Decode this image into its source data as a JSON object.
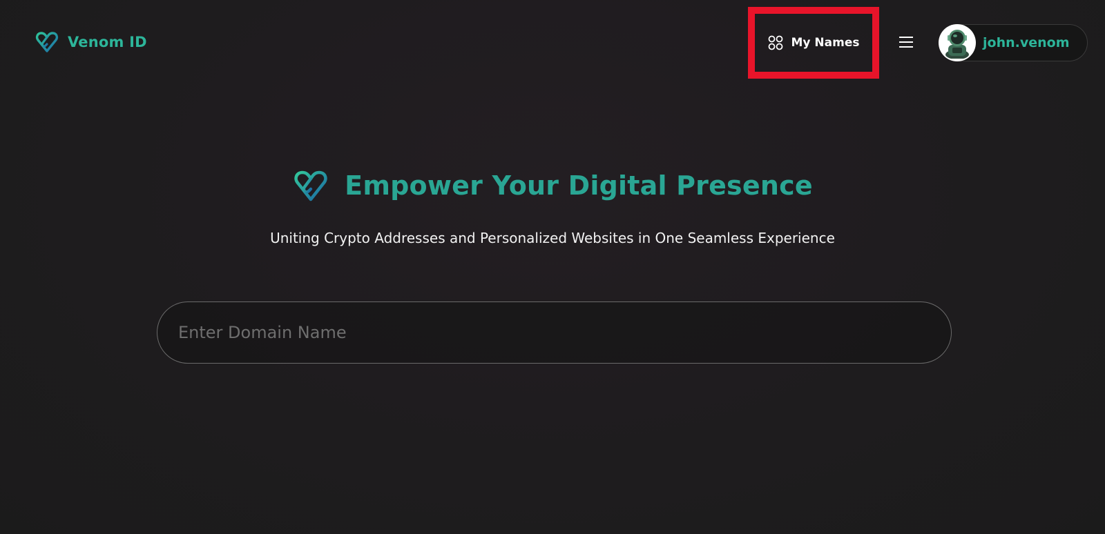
{
  "brand": {
    "name": "Venom ID",
    "logo_icon": "venom-logo-icon"
  },
  "nav": {
    "my_names_label": "My Names",
    "my_names_icon": "grid-circles-icon",
    "highlight_color": "#e8142a",
    "menu_icon": "hamburger-menu-icon"
  },
  "profile": {
    "name": "john.venom",
    "avatar_icon": "astronaut-avatar-icon"
  },
  "hero": {
    "title": "Empower Your Digital Presence",
    "subtitle": "Uniting Crypto Addresses and Personalized Websites in One Seamless Experience"
  },
  "search": {
    "placeholder": "Enter Domain Name",
    "value": ""
  },
  "colors": {
    "accent": "#2db59a",
    "accent_secondary": "#1f7fa6",
    "background": "#1e1c1e"
  }
}
